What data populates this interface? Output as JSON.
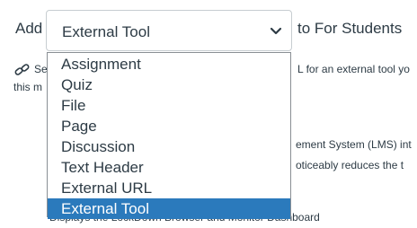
{
  "add_label": "Add",
  "to_label": "to For Students",
  "select": {
    "value": "External Tool",
    "options": [
      "Assignment",
      "Quiz",
      "File",
      "Page",
      "Discussion",
      "Text Header",
      "External URL",
      "External Tool"
    ],
    "selected_index": 7
  },
  "background": {
    "line1_left": "Se",
    "line1_right": "L for an external tool yo",
    "line2_left": "this m",
    "line3_right": "ement System (LMS) int",
    "line4_right": "oticeably reduces the t",
    "line5": "Displays the LockDown Browser and Monitor Dashboard"
  },
  "colors": {
    "text": "#2d3b45",
    "selected_bg": "#2b7abc",
    "selected_text": "#ffffff",
    "border": "#c7cdd1"
  }
}
